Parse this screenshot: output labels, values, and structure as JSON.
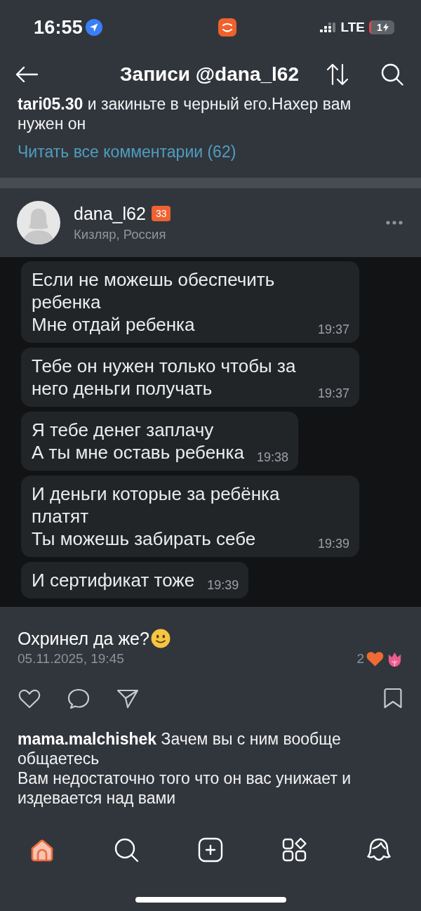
{
  "status_bar": {
    "time": "16:55",
    "network": "LTE",
    "battery": "1"
  },
  "header": {
    "title": "Записи @dana_l62"
  },
  "previous_post": {
    "comment": {
      "author": "tari05.30",
      "text": "и закиньте в черный его.Нахер вам нужен он"
    },
    "read_all": "Читать все комментарии (62)"
  },
  "post": {
    "author": "dana_l62",
    "badge": "33",
    "location": "Кизляр, Россия",
    "chat_screenshot": {
      "messages": [
        {
          "text": "Если не можешь обеспечить ребенка\nМне отдай ребенка",
          "time": "19:37"
        },
        {
          "text": "Тебе он нужен только чтобы за него деньги получать",
          "time": "19:37"
        },
        {
          "text": "Я тебе денег заплачу\nА ты мне оставь ребенка",
          "time": "19:38"
        },
        {
          "text": "И деньги которые за ребёнка платят\nТы можешь забирать себе",
          "time": "19:39"
        },
        {
          "text": "И сертификат тоже",
          "time": "19:39"
        }
      ]
    },
    "caption": "Охринел да же?",
    "date": "05.11.2025, 19:45",
    "reaction_count": "2",
    "liked": false,
    "saved": false,
    "comments": [
      {
        "author": "mama.malchishek",
        "text": "Зачем вы с ним вообще общаетесь\nВам недостаточно того что он вас унижает и издевается над вами"
      }
    ]
  },
  "tab_bar": [
    {
      "selected": true
    },
    {
      "selected": false
    },
    {
      "selected": false
    },
    {
      "selected": false
    },
    {
      "selected": false
    }
  ]
}
